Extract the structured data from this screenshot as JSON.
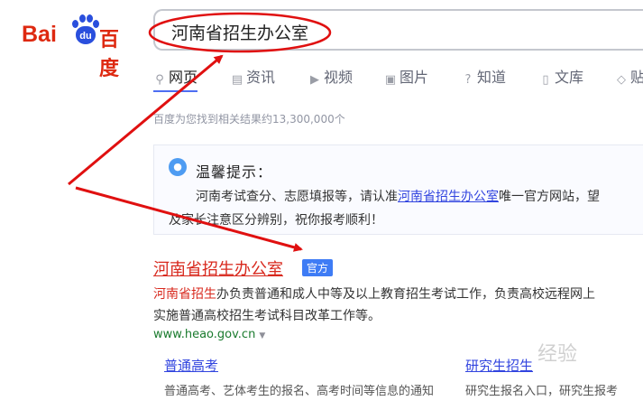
{
  "logo": {
    "bai": "Bai",
    "paw": "du",
    "du": "百度"
  },
  "search": {
    "value": "河南省招生办公室"
  },
  "tabs": [
    {
      "label": "网页",
      "icon": "search-icon"
    },
    {
      "label": "资讯",
      "icon": "news-icon"
    },
    {
      "label": "视频",
      "icon": "video-icon"
    },
    {
      "label": "图片",
      "icon": "image-icon"
    },
    {
      "label": "知道",
      "icon": "question-icon"
    },
    {
      "label": "文库",
      "icon": "document-icon"
    },
    {
      "label": "贴",
      "icon": "tieba-icon"
    }
  ],
  "result_count": "百度为您找到相关结果约13,300,000个",
  "tip": {
    "title": "温馨提示：",
    "line1_prefix": "河南考试查分、志愿填报等，请认准",
    "line1_link": "河南省招生办公室",
    "line1_suffix": "唯一官方网站，望",
    "line2": "及家长注意区分辨别，祝你报考顺利！"
  },
  "result": {
    "title": "河南省招生办公室",
    "badge": "官方",
    "desc_highlight": "河南省招生",
    "desc_rest": "办负责普通和成人中等及以上教育招生考试工作，负责高校远程网上",
    "desc_line2": "实施普通高校招生考试科目改革工作等。",
    "url": "www.heao.gov.cn",
    "sublinks": [
      {
        "title": "普通高考",
        "desc": "普通高考、艺体考生的报名、高考时间等信息的通知"
      },
      {
        "title": "研究生招生",
        "desc": "研究生报名入口，研究生报考"
      }
    ]
  },
  "watermark": "经验",
  "colors": {
    "accent": "#4e6ef2",
    "title_red": "#d8291e",
    "link_blue": "#3245df",
    "url_green": "#1a7b2e",
    "annotation_red": "#e01010"
  }
}
